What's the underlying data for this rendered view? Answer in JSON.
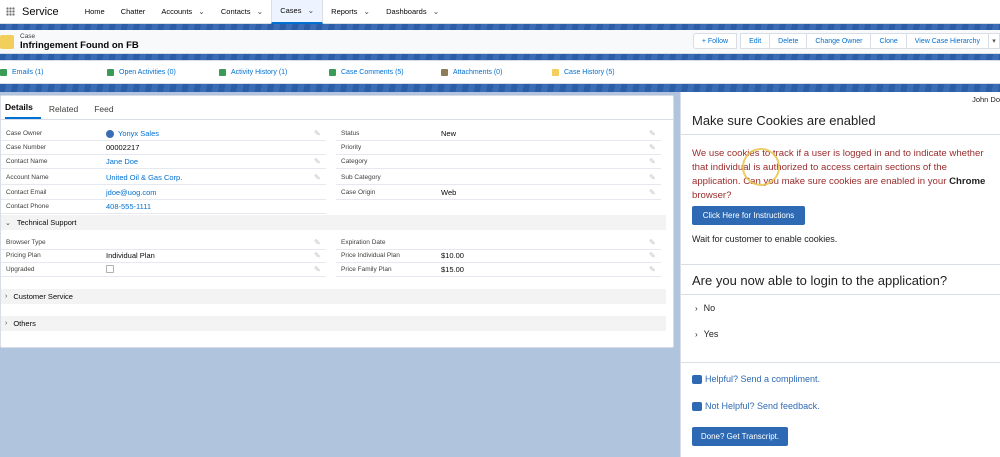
{
  "nav": {
    "app_name": "Service",
    "items": [
      "Home",
      "Chatter",
      "Accounts",
      "Contacts",
      "Cases",
      "Reports",
      "Dashboards"
    ]
  },
  "record": {
    "type_label": "Case",
    "title": "Infringement Found on FB",
    "actions": [
      "+ Follow",
      "Edit",
      "Delete",
      "Change Owner",
      "Clone",
      "View Case Hierarchy"
    ]
  },
  "related": [
    {
      "label": "Emails (1)",
      "color": "#3a9b56"
    },
    {
      "label": "Open Activities (0)",
      "color": "#3a9b56"
    },
    {
      "label": "Activity History (1)",
      "color": "#3a9b56"
    },
    {
      "label": "Case Comments (5)",
      "color": "#3a9b56"
    },
    {
      "label": "Attachments (0)",
      "color": "#8b7d5a"
    },
    {
      "label": "Case History (5)",
      "color": "#f2cf5b"
    }
  ],
  "tabs": [
    "Details",
    "Related",
    "Feed"
  ],
  "fields": {
    "case_owner": {
      "label": "Case Owner",
      "value": "Yonyx Sales"
    },
    "case_number": {
      "label": "Case Number",
      "value": "00002217"
    },
    "contact_name": {
      "label": "Contact Name",
      "value": "Jane Doe"
    },
    "account_name": {
      "label": "Account Name",
      "value": "United Oil & Gas Corp."
    },
    "contact_email": {
      "label": "Contact Email",
      "value": "jdoe@uog.com"
    },
    "contact_phone": {
      "label": "Contact Phone",
      "value": "408-555-1111"
    },
    "status": {
      "label": "Status",
      "value": "New"
    },
    "priority": {
      "label": "Priority",
      "value": ""
    },
    "category": {
      "label": "Category",
      "value": ""
    },
    "sub_category": {
      "label": "Sub Category",
      "value": ""
    },
    "case_origin": {
      "label": "Case Origin",
      "value": "Web"
    },
    "browser_type": {
      "label": "Browser Type",
      "value": ""
    },
    "pricing_plan": {
      "label": "Pricing Plan",
      "value": "Individual Plan"
    },
    "upgraded": {
      "label": "Upgraded",
      "value": ""
    },
    "expiration_date": {
      "label": "Expiration Date",
      "value": ""
    },
    "price_individual": {
      "label": "Price Individual Plan",
      "value": "$10.00"
    },
    "price_family": {
      "label": "Price Family Plan",
      "value": "$15.00"
    }
  },
  "sections": {
    "technical": "Technical Support",
    "customer": "Customer Service",
    "others": "Others"
  },
  "panel": {
    "user": "John Do",
    "heading1": "Make sure Cookies are enabled",
    "warning_pre": "We use cookies to track if a user is logged in and to indicate whether that individual is authorized to access certain sections of the application. Can you make sure cookies are enabled in your ",
    "warning_bold": "Chrome",
    "warning_post": " browser?",
    "instructions_btn": "Click Here for Instructions",
    "wait_text": "Wait for customer to enable cookies.",
    "heading2": "Are you now able to login to the application?",
    "option_no": "No",
    "option_yes": "Yes",
    "helpful": "Helpful? Send a compliment.",
    "not_helpful": "Not Helpful? Send feedback.",
    "transcript_btn": "Done? Get Transcript."
  }
}
